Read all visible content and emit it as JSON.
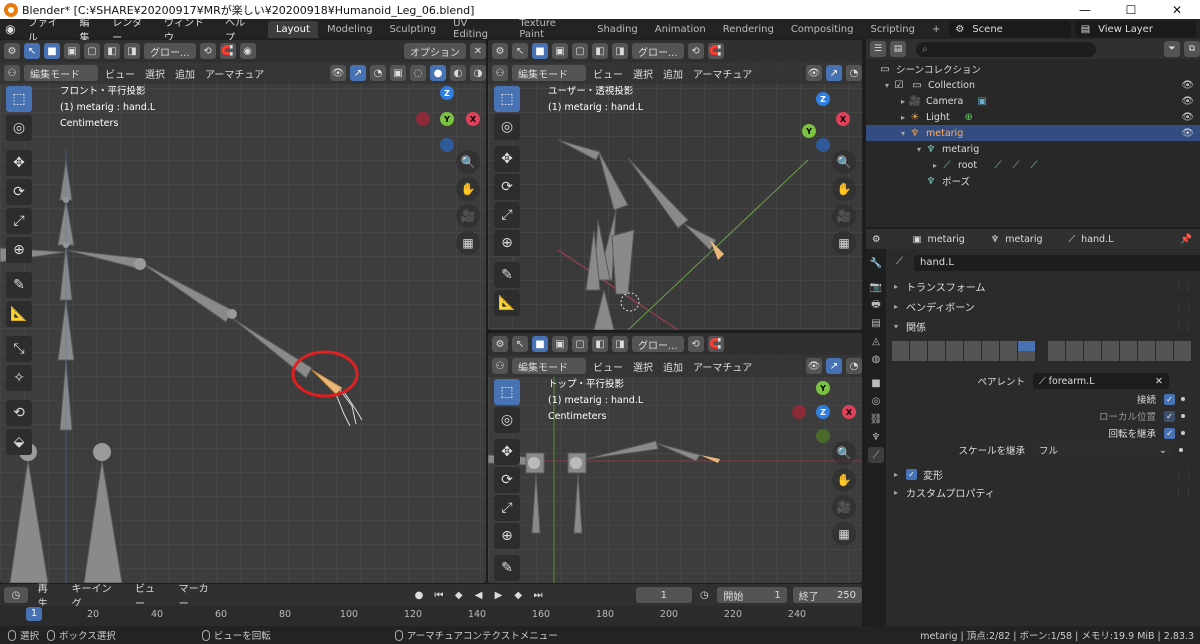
{
  "window": {
    "title": "Blender* [C:¥SHARE¥20200917¥MRが楽しい¥20200918¥Humanoid_Leg_06.blend]",
    "min": "—",
    "max": "☐",
    "close": "✕"
  },
  "menus": [
    "ファイル",
    "編集",
    "レンダー",
    "ウィンドウ",
    "ヘルプ"
  ],
  "workspaces": [
    "Layout",
    "Modeling",
    "Sculpting",
    "UV Editing",
    "Texture Paint",
    "Shading",
    "Animation",
    "Rendering",
    "Compositing",
    "Scripting",
    "+"
  ],
  "scene": {
    "scene_label": "Scene",
    "view_layer_label": "View Layer"
  },
  "viewport_common": {
    "mode": "編集モード",
    "view_menu": "ビュー",
    "select_menu": "選択",
    "add_menu": "追加",
    "armature_menu": "アーマチュア",
    "transform_orient": "グロー...",
    "options": "オプション"
  },
  "viewports": {
    "front": {
      "line1": "フロント・平行投影",
      "line2": "(1) metarig : hand.L",
      "line3": "Centimeters"
    },
    "user": {
      "line1": "ユーザー・透視投影",
      "line2": "(1) metarig : hand.L"
    },
    "top": {
      "line1": "トップ・平行投影",
      "line2": "(1) metarig : hand.L",
      "line3": "Centimeters"
    }
  },
  "tools": [
    "select-box",
    "cursor",
    "move",
    "rotate",
    "scale",
    "transform",
    "annotate",
    "measure",
    "bone-size",
    "bone-envelope",
    "roll",
    "extrude"
  ],
  "tool_glyphs": [
    "⬚",
    "◎",
    "✥",
    "⟳",
    "⤢",
    "⊕",
    "✎",
    "📐",
    "⤡",
    "✧",
    "⟲",
    "⬙"
  ],
  "nav_glyphs": [
    "🔍",
    "✋",
    "🎥",
    "▦"
  ],
  "gizmo": {
    "z": "Z",
    "y": "Y",
    "x": "X"
  },
  "timeline": {
    "playback": "再生",
    "keying": "キーイング",
    "view": "ビュー",
    "marker": "マーカー",
    "current_frame": "1",
    "start_label": "開始",
    "start": "1",
    "end_label": "終了",
    "end": "250",
    "ticks": [
      "1",
      "20",
      "40",
      "60",
      "80",
      "100",
      "120",
      "140",
      "160",
      "180",
      "200",
      "220",
      "240"
    ]
  },
  "statusbar": {
    "select": "選択",
    "box_select": "ボックス選択",
    "rotate_view": "ビューを回転",
    "context_menu": "アーマチュアコンテクストメニュー",
    "stats": "metarig | 頂点:2/82 | ボーン:1/58 | メモリ:19.9 MiB | 2.83.3"
  },
  "outliner": {
    "search_placeholder": "",
    "rows": [
      {
        "label": "シーンコレクション"
      },
      {
        "label": "Collection"
      },
      {
        "label": "Camera"
      },
      {
        "label": "Light"
      },
      {
        "label": "metarig"
      },
      {
        "label": "metarig"
      },
      {
        "label": "root"
      },
      {
        "label": "ポーズ"
      }
    ]
  },
  "properties": {
    "breadcrumb": [
      "metarig",
      "metarig",
      "hand.L"
    ],
    "bone_name": "hand.L",
    "panels": {
      "transform": "トランスフォーム",
      "bendy": "ベンディボーン",
      "relations": "関係",
      "deform": "変形",
      "custom_props": "カスタムプロパティ"
    },
    "parent_label": "ペアレント",
    "parent_value": "forearm.L",
    "connected_label": "接続",
    "local_location_label": "ローカル位置",
    "inherit_rotation_label": "回転を継承",
    "inherit_scale_label": "スケールを継承",
    "inherit_scale_value": "フル"
  },
  "colors": {
    "accent": "#4772b3",
    "selected_row": "#334d80",
    "bone_highlight": "#e8b87a",
    "circle_annotation": "#e02020"
  }
}
